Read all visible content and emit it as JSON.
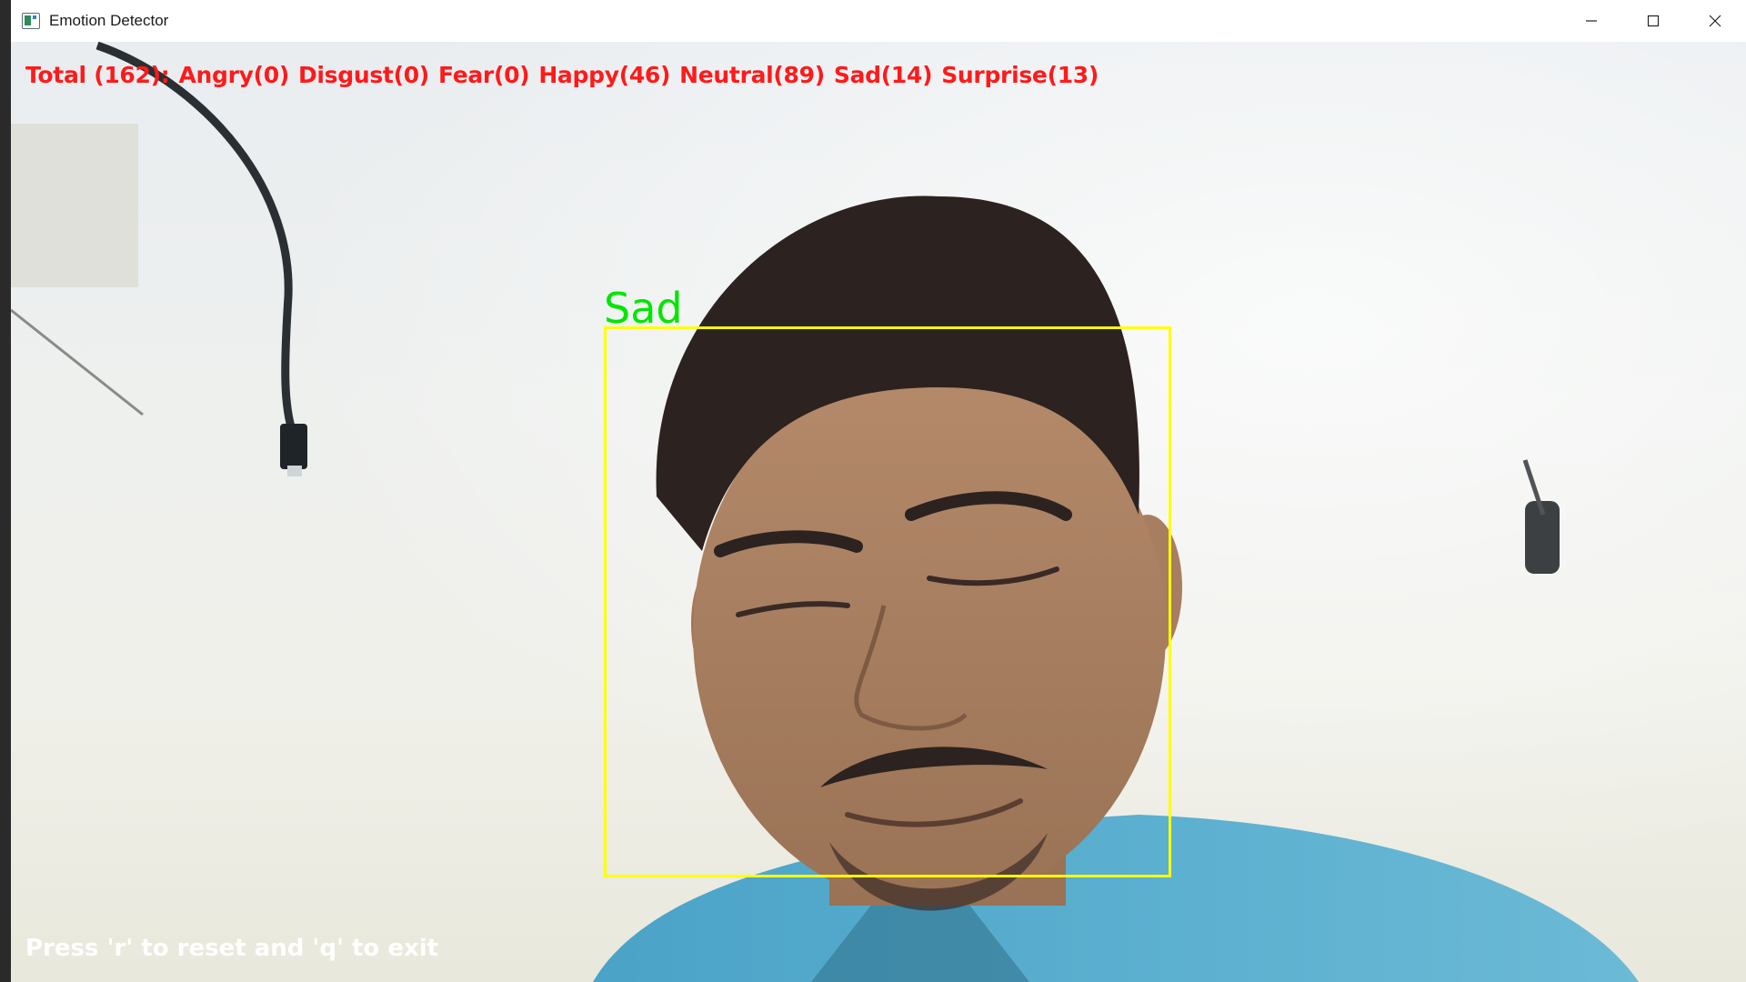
{
  "window": {
    "title": "Emotion Detector",
    "icon": "app-icon",
    "controls": [
      "minimize-icon",
      "maximize-icon",
      "close-icon"
    ]
  },
  "overlay": {
    "stats": {
      "total": "Total (162):",
      "angry": "Angry(0)",
      "disgust": "Disgust(0)",
      "fear": "Fear(0)",
      "happy": "Happy(46)",
      "neutral": "Neutral(89)",
      "sad": "Sad(14)",
      "surprise": "Surprise(13)"
    },
    "detection_label": "Sad",
    "hint": "Press 'r' to reset and 'q' to exit"
  },
  "colors": {
    "stats_text": "#ff1a1a",
    "box_outline": "#ffff00",
    "label_text": "#00e600",
    "hint_text": "#ffffff"
  }
}
